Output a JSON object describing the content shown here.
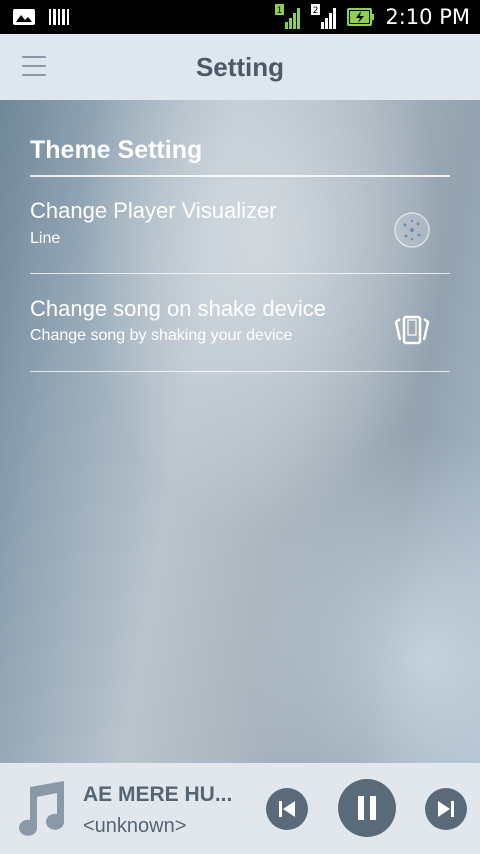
{
  "status_bar": {
    "time": "2:10 PM",
    "sim1_label": "1",
    "sim2_label": "2"
  },
  "app_bar": {
    "title": "Setting",
    "menu_icon": "hamburger-menu-icon"
  },
  "settings": {
    "section_title": "Theme Setting",
    "items": [
      {
        "title": "Change Player Visualizer",
        "subtitle": "Line",
        "icon": "visualizer-icon"
      },
      {
        "title": "Change song on shake device",
        "subtitle": "Change song by shaking your device",
        "icon": "shake-phone-icon"
      }
    ]
  },
  "player": {
    "track_title": "AE MERE HU...",
    "track_artist": "<unknown>",
    "album_icon": "music-note-icon",
    "controls": [
      "previous-icon",
      "pause-icon",
      "next-icon"
    ]
  },
  "colors": {
    "status_bar_bg": "#000000",
    "app_bar_bg": "#dfe7ee",
    "title_text": "#4c5a67",
    "player_bg": "#e1e7ed",
    "control_bg": "#5a6a79",
    "signal_green": "#8fd14f"
  }
}
